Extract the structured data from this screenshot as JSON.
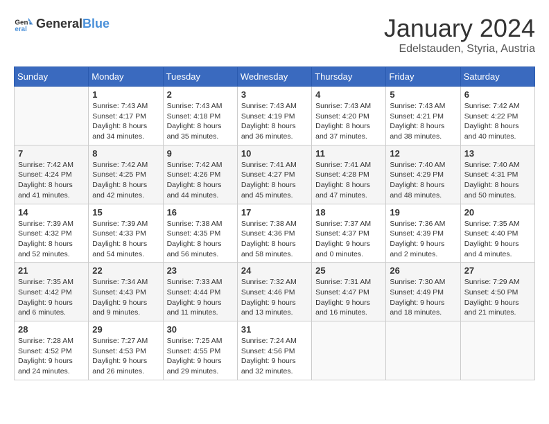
{
  "header": {
    "logo_general": "General",
    "logo_blue": "Blue",
    "month": "January 2024",
    "location": "Edelstauden, Styria, Austria"
  },
  "weekdays": [
    "Sunday",
    "Monday",
    "Tuesday",
    "Wednesday",
    "Thursday",
    "Friday",
    "Saturday"
  ],
  "weeks": [
    [
      {
        "day": "",
        "content": ""
      },
      {
        "day": "1",
        "content": "Sunrise: 7:43 AM\nSunset: 4:17 PM\nDaylight: 8 hours\nand 34 minutes."
      },
      {
        "day": "2",
        "content": "Sunrise: 7:43 AM\nSunset: 4:18 PM\nDaylight: 8 hours\nand 35 minutes."
      },
      {
        "day": "3",
        "content": "Sunrise: 7:43 AM\nSunset: 4:19 PM\nDaylight: 8 hours\nand 36 minutes."
      },
      {
        "day": "4",
        "content": "Sunrise: 7:43 AM\nSunset: 4:20 PM\nDaylight: 8 hours\nand 37 minutes."
      },
      {
        "day": "5",
        "content": "Sunrise: 7:43 AM\nSunset: 4:21 PM\nDaylight: 8 hours\nand 38 minutes."
      },
      {
        "day": "6",
        "content": "Sunrise: 7:42 AM\nSunset: 4:22 PM\nDaylight: 8 hours\nand 40 minutes."
      }
    ],
    [
      {
        "day": "7",
        "content": "Sunrise: 7:42 AM\nSunset: 4:24 PM\nDaylight: 8 hours\nand 41 minutes."
      },
      {
        "day": "8",
        "content": "Sunrise: 7:42 AM\nSunset: 4:25 PM\nDaylight: 8 hours\nand 42 minutes."
      },
      {
        "day": "9",
        "content": "Sunrise: 7:42 AM\nSunset: 4:26 PM\nDaylight: 8 hours\nand 44 minutes."
      },
      {
        "day": "10",
        "content": "Sunrise: 7:41 AM\nSunset: 4:27 PM\nDaylight: 8 hours\nand 45 minutes."
      },
      {
        "day": "11",
        "content": "Sunrise: 7:41 AM\nSunset: 4:28 PM\nDaylight: 8 hours\nand 47 minutes."
      },
      {
        "day": "12",
        "content": "Sunrise: 7:40 AM\nSunset: 4:29 PM\nDaylight: 8 hours\nand 48 minutes."
      },
      {
        "day": "13",
        "content": "Sunrise: 7:40 AM\nSunset: 4:31 PM\nDaylight: 8 hours\nand 50 minutes."
      }
    ],
    [
      {
        "day": "14",
        "content": "Sunrise: 7:39 AM\nSunset: 4:32 PM\nDaylight: 8 hours\nand 52 minutes."
      },
      {
        "day": "15",
        "content": "Sunrise: 7:39 AM\nSunset: 4:33 PM\nDaylight: 8 hours\nand 54 minutes."
      },
      {
        "day": "16",
        "content": "Sunrise: 7:38 AM\nSunset: 4:35 PM\nDaylight: 8 hours\nand 56 minutes."
      },
      {
        "day": "17",
        "content": "Sunrise: 7:38 AM\nSunset: 4:36 PM\nDaylight: 8 hours\nand 58 minutes."
      },
      {
        "day": "18",
        "content": "Sunrise: 7:37 AM\nSunset: 4:37 PM\nDaylight: 9 hours\nand 0 minutes."
      },
      {
        "day": "19",
        "content": "Sunrise: 7:36 AM\nSunset: 4:39 PM\nDaylight: 9 hours\nand 2 minutes."
      },
      {
        "day": "20",
        "content": "Sunrise: 7:35 AM\nSunset: 4:40 PM\nDaylight: 9 hours\nand 4 minutes."
      }
    ],
    [
      {
        "day": "21",
        "content": "Sunrise: 7:35 AM\nSunset: 4:42 PM\nDaylight: 9 hours\nand 6 minutes."
      },
      {
        "day": "22",
        "content": "Sunrise: 7:34 AM\nSunset: 4:43 PM\nDaylight: 9 hours\nand 9 minutes."
      },
      {
        "day": "23",
        "content": "Sunrise: 7:33 AM\nSunset: 4:44 PM\nDaylight: 9 hours\nand 11 minutes."
      },
      {
        "day": "24",
        "content": "Sunrise: 7:32 AM\nSunset: 4:46 PM\nDaylight: 9 hours\nand 13 minutes."
      },
      {
        "day": "25",
        "content": "Sunrise: 7:31 AM\nSunset: 4:47 PM\nDaylight: 9 hours\nand 16 minutes."
      },
      {
        "day": "26",
        "content": "Sunrise: 7:30 AM\nSunset: 4:49 PM\nDaylight: 9 hours\nand 18 minutes."
      },
      {
        "day": "27",
        "content": "Sunrise: 7:29 AM\nSunset: 4:50 PM\nDaylight: 9 hours\nand 21 minutes."
      }
    ],
    [
      {
        "day": "28",
        "content": "Sunrise: 7:28 AM\nSunset: 4:52 PM\nDaylight: 9 hours\nand 24 minutes."
      },
      {
        "day": "29",
        "content": "Sunrise: 7:27 AM\nSunset: 4:53 PM\nDaylight: 9 hours\nand 26 minutes."
      },
      {
        "day": "30",
        "content": "Sunrise: 7:25 AM\nSunset: 4:55 PM\nDaylight: 9 hours\nand 29 minutes."
      },
      {
        "day": "31",
        "content": "Sunrise: 7:24 AM\nSunset: 4:56 PM\nDaylight: 9 hours\nand 32 minutes."
      },
      {
        "day": "",
        "content": ""
      },
      {
        "day": "",
        "content": ""
      },
      {
        "day": "",
        "content": ""
      }
    ]
  ]
}
